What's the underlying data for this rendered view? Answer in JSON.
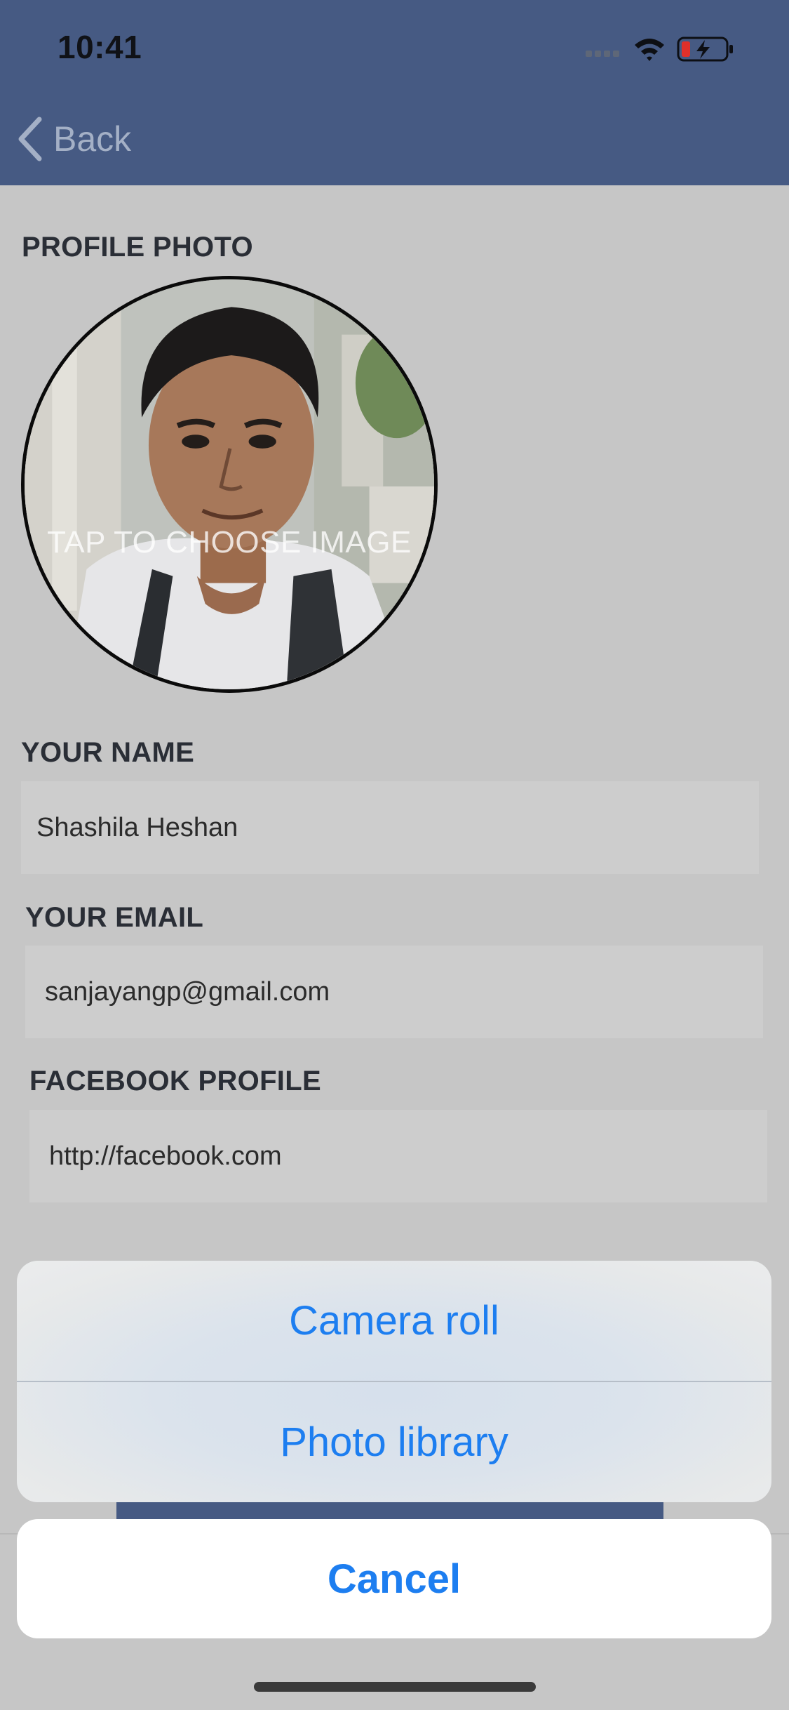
{
  "status_bar": {
    "time": "10:41",
    "icons": [
      "signal-dots-icon",
      "wifi-icon",
      "battery-charging-icon"
    ],
    "battery_color": "#e0302a"
  },
  "nav": {
    "back_label": "Back",
    "back_icon": "chevron-left-icon"
  },
  "profile_photo": {
    "label": "PROFILE PHOTO",
    "hint": "TAP TO CHOOSE IMAGE"
  },
  "form": {
    "name": {
      "label": "YOUR NAME",
      "value": "Shashila Heshan"
    },
    "email": {
      "label": "YOUR EMAIL",
      "value": "sanjayangp@gmail.com"
    },
    "facebook": {
      "label": "FACEBOOK PROFILE",
      "value": "http://facebook.com"
    }
  },
  "action_sheet": {
    "options": [
      "Camera roll",
      "Photo library"
    ],
    "cancel_label": "Cancel"
  },
  "colors": {
    "nav_bar": "#465a83",
    "accent_blue": "#1d7ef0",
    "dim_background": "#c6c6c6"
  }
}
